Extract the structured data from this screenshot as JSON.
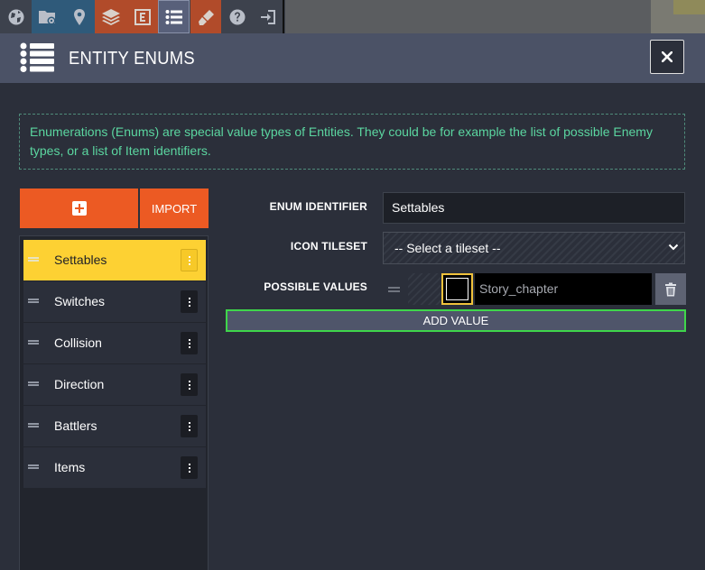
{
  "toolbar": {
    "buttons": [
      {
        "name": "world-icon",
        "color": "#3d424d"
      },
      {
        "name": "project-settings-icon",
        "color": "#2f5a7a"
      },
      {
        "name": "level-location-icon",
        "color": "#2f5a7a"
      },
      {
        "name": "layers-icon",
        "color": "#b14b2a"
      },
      {
        "name": "entities-icon",
        "color": "#b14b2a"
      },
      {
        "name": "enums-icon",
        "color": "#58607a"
      },
      {
        "name": "tilesets-icon",
        "color": "#b14b2a"
      },
      {
        "name": "help-icon",
        "color": "#3d424d"
      },
      {
        "name": "exit-icon",
        "color": "#3d424d"
      }
    ]
  },
  "header": {
    "title": "ENTITY ENUMS",
    "close_label": "×"
  },
  "info": {
    "text": "Enumerations (Enums) are special value types of Entities. They could be for example the list of possible Enemy types, or a list of Item identifiers."
  },
  "sidebar": {
    "add_label": "+",
    "import_label": "IMPORT",
    "items": [
      {
        "label": "Settables",
        "selected": true
      },
      {
        "label": "Switches",
        "selected": false
      },
      {
        "label": "Collision",
        "selected": false
      },
      {
        "label": "Direction",
        "selected": false
      },
      {
        "label": "Battlers",
        "selected": false
      },
      {
        "label": "Items",
        "selected": false
      }
    ]
  },
  "form": {
    "identifier_label": "ENUM IDENTIFIER",
    "identifier_value": "Settables",
    "icon_tileset_label": "ICON TILESET",
    "icon_tileset_value": "-- Select a tileset --",
    "possible_values_label": "POSSIBLE VALUES",
    "values": [
      {
        "name": "Story_chapter",
        "color": "#000000"
      }
    ],
    "add_value_label": "ADD VALUE"
  },
  "colors": {
    "accent": "#ec5a23",
    "selected": "#fdd133",
    "info_text": "#5bd6a0",
    "add_value_border": "#3fd64b"
  }
}
